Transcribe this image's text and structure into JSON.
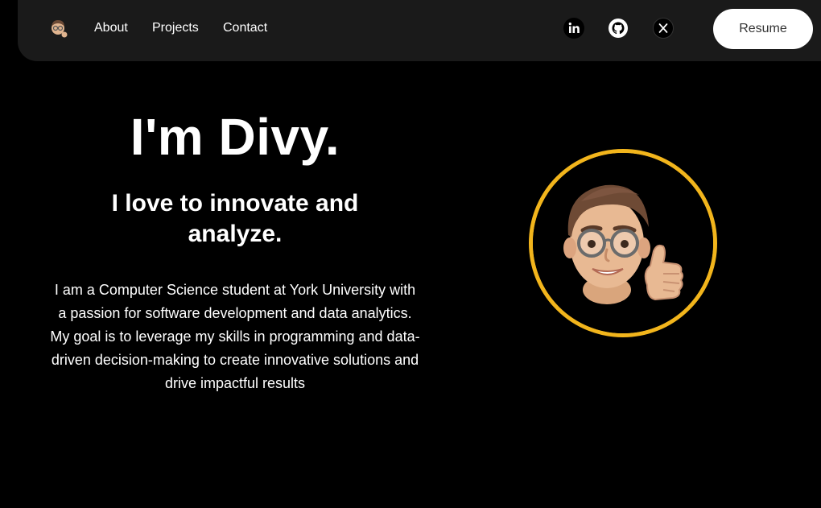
{
  "nav": {
    "links": [
      "About",
      "Projects",
      "Contact"
    ],
    "socials": [
      "linkedin-icon",
      "github-icon",
      "x-icon"
    ],
    "resume_label": "Resume"
  },
  "hero": {
    "title": "I'm Divy.",
    "subtitle": "I love to innovate and analyze.",
    "description": "I am a Computer Science student at York University with a passion for software development and data analytics. My goal is to leverage my skills in programming and data-driven decision-making to create innovative solutions and drive impactful results"
  },
  "colors": {
    "background": "#000000",
    "navbar": "#1a1a1a",
    "accent_ring": "#f2b51c",
    "button_bg": "#ffffff"
  }
}
